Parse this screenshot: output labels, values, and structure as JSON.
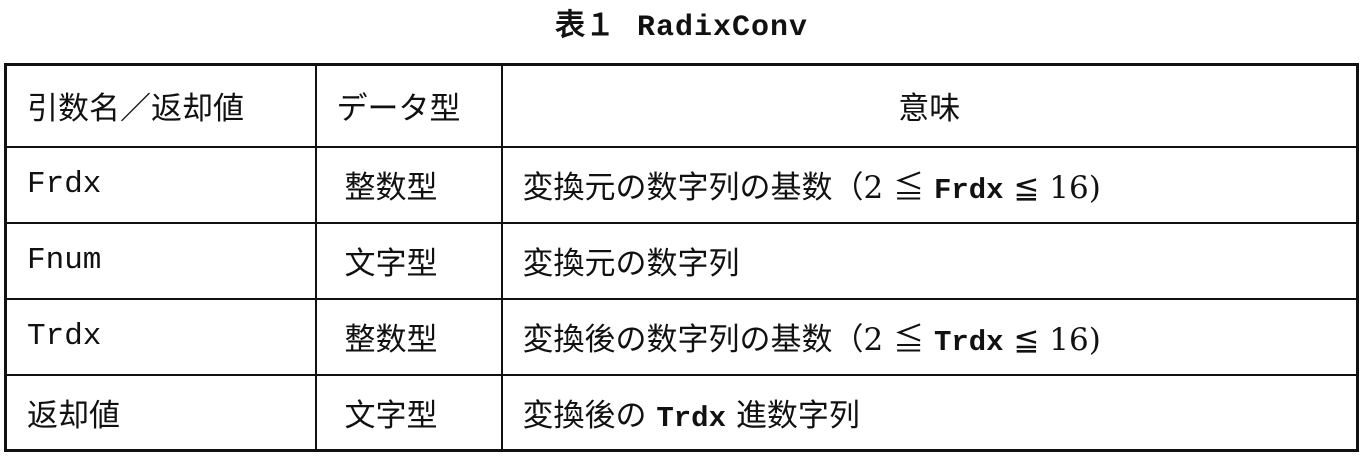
{
  "caption": {
    "number": "表１",
    "name": "RadixConv"
  },
  "table": {
    "headers": [
      "引数名／返却値",
      "データ型",
      "意味"
    ],
    "rows": [
      {
        "name": "Frdx",
        "type": "整数型",
        "meaning": [
          "変換元の数字列の基数（2 ≦ ",
          "Frdx",
          " ≦ 16)"
        ]
      },
      {
        "name": "Fnum",
        "type": "文字型",
        "meaning": [
          "変換元の数字列"
        ]
      },
      {
        "name": "Trdx",
        "type": "整数型",
        "meaning": [
          "変換後の数字列の基数（2 ≦ ",
          "Trdx",
          " ≦ 16)"
        ]
      },
      {
        "name": "返却値",
        "type": "文字型",
        "meaning": [
          "変換後の ",
          "Trdx",
          " 進数字列"
        ]
      }
    ]
  }
}
